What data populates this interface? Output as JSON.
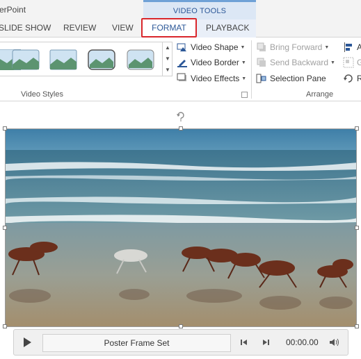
{
  "app": {
    "title": "erPoint"
  },
  "context_tab_group": {
    "label": "VIDEO TOOLS"
  },
  "tabs": [
    {
      "label": "SLIDE SHOW"
    },
    {
      "label": "REVIEW"
    },
    {
      "label": "VIEW"
    },
    {
      "label": "FORMAT",
      "active": true
    },
    {
      "label": "PLAYBACK"
    }
  ],
  "ribbon": {
    "video_styles_group": {
      "label": "Video Styles",
      "buttons": [
        {
          "label": "Video Shape",
          "icon": "video-shape-icon"
        },
        {
          "label": "Video Border",
          "icon": "video-border-icon"
        },
        {
          "label": "Video Effects",
          "icon": "video-effects-icon"
        }
      ]
    },
    "arrange_group": {
      "label": "Arrange",
      "buttons": [
        {
          "label": "Bring Forward",
          "enabled": false
        },
        {
          "label": "Send Backward",
          "enabled": false
        },
        {
          "label": "Selection Pane",
          "enabled": true
        }
      ],
      "partial_buttons": [
        "Al",
        "Gr",
        "Ro"
      ]
    }
  },
  "player": {
    "poster_text": "Poster Frame Set",
    "time": "00:00.00"
  },
  "colors": {
    "accent": "#2b5797",
    "highlight": "#d9262b",
    "context_band": "#dce7f5"
  }
}
